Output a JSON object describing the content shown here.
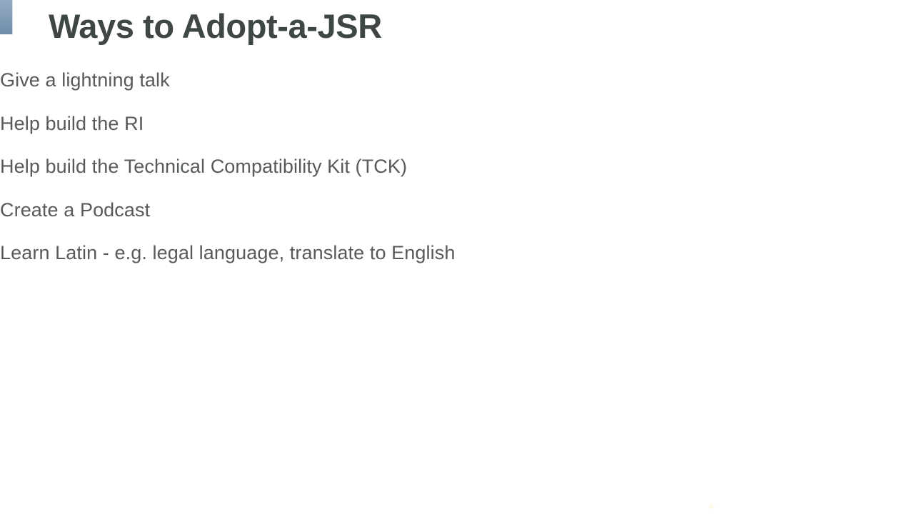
{
  "slide": {
    "title": "Ways to Adopt-a-JSR",
    "accent_bar_color_top": "#92aac1",
    "accent_bar_color_bottom": "#6e8ca8",
    "title_color": "#3e4744",
    "body_text_color": "#565a58",
    "background_color": "#ffffff",
    "bullets": [
      {
        "text": "Give a lightning talk"
      },
      {
        "text": "Help build the RI"
      },
      {
        "text": "Help build the Technical Compatibility Kit (TCK)"
      },
      {
        "text": "Create a Podcast"
      },
      {
        "text": "Learn Latin - e.g. legal language, translate to English"
      }
    ],
    "artifact": {
      "glyph": "✦"
    }
  }
}
